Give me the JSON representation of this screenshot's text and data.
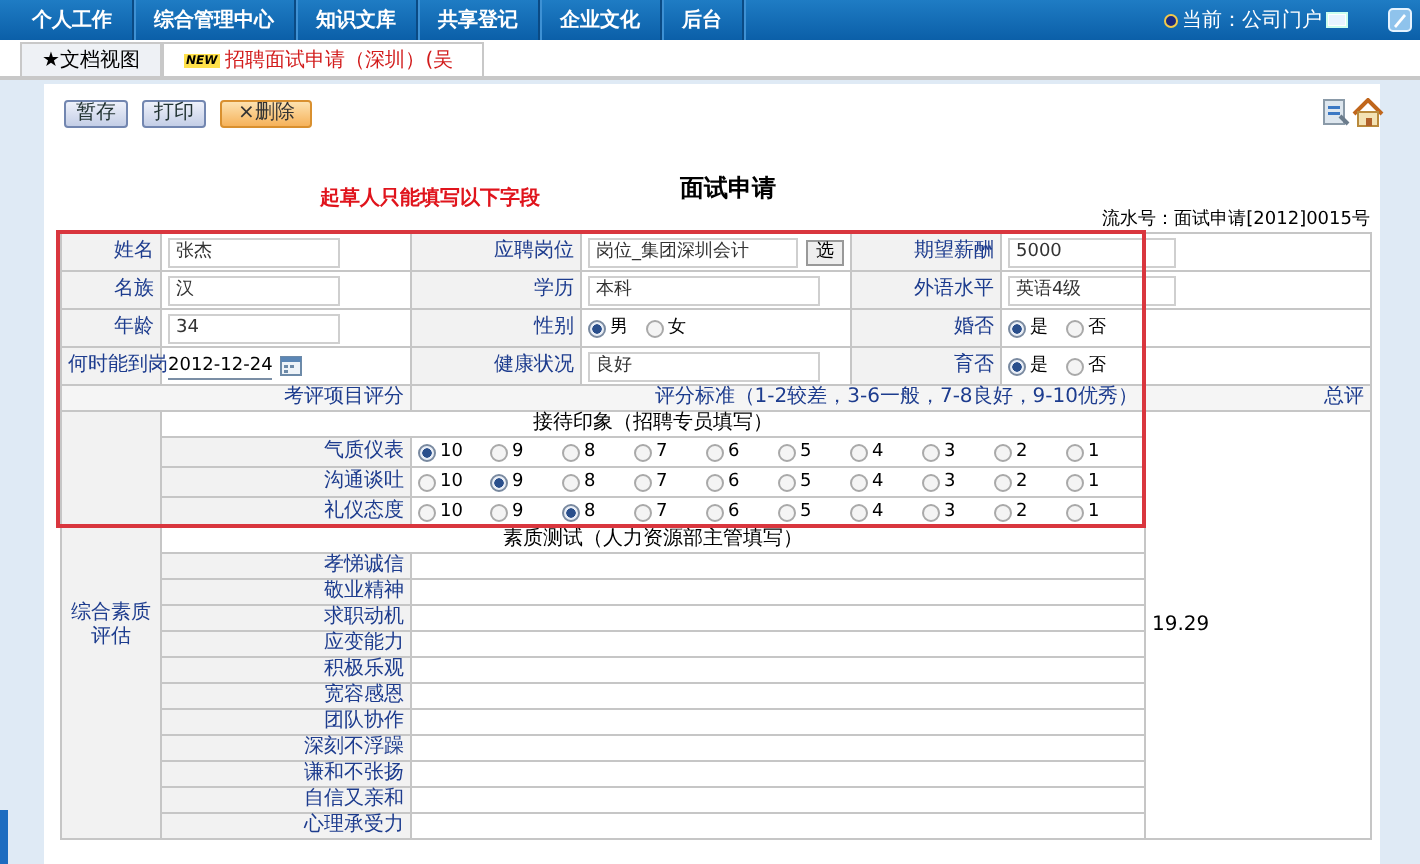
{
  "nav": {
    "items": [
      {
        "label": "个人工作"
      },
      {
        "label": "综合管理中心"
      },
      {
        "label": "知识文库"
      },
      {
        "label": "共享登记"
      },
      {
        "label": "企业文化"
      },
      {
        "label": "后台"
      }
    ],
    "current": "当前：公司门户"
  },
  "tabs": [
    {
      "label": "★文档视图",
      "selected": false
    },
    {
      "label": "招聘面试申请（深圳）(吴",
      "badge": "NEW",
      "selected": true
    }
  ],
  "toolbar": [
    {
      "label": "暂存",
      "kind": "normal"
    },
    {
      "label": "打印",
      "kind": "normal"
    },
    {
      "label": "×删除",
      "kind": "danger"
    }
  ],
  "form": {
    "title": "面试申请",
    "note": "起草人只能填写以下字段",
    "serial": "流水号：面试申请[2012]0015号",
    "rows": [
      [
        {
          "label": "姓名",
          "kind": "text",
          "value": "张杰"
        },
        {
          "label": "应聘岗位",
          "kind": "pick",
          "value": "岗位_集团深圳会计",
          "button": "选"
        },
        {
          "label": "期望薪酬",
          "kind": "text",
          "value": "5000"
        }
      ],
      [
        {
          "label": "名族",
          "kind": "text",
          "value": "汉"
        },
        {
          "label": "学历",
          "kind": "text",
          "value": "本科"
        },
        {
          "label": "外语水平",
          "kind": "text",
          "value": "英语4级"
        }
      ],
      [
        {
          "label": "年龄",
          "kind": "text",
          "value": "34"
        },
        {
          "label": "性别",
          "kind": "radio",
          "options": [
            {
              "label": "男",
              "selected": true
            },
            {
              "label": "女",
              "selected": false
            }
          ]
        },
        {
          "label": "婚否",
          "kind": "radio",
          "options": [
            {
              "label": "是",
              "selected": true
            },
            {
              "label": "否",
              "selected": false
            }
          ]
        }
      ],
      [
        {
          "label": "何时能到岗",
          "kind": "date",
          "value": "2012-12-24"
        },
        {
          "label": "健康状况",
          "kind": "text",
          "value": "良好"
        },
        {
          "label": "育否",
          "kind": "radio",
          "options": [
            {
              "label": "是",
              "selected": true
            },
            {
              "label": "否",
              "selected": false
            }
          ]
        }
      ]
    ]
  },
  "scoring": {
    "heading": "考评项目评分",
    "criteria": "评分标准（1-2较差，3-6一般，7-8良好，9-10优秀）",
    "total_heading": "总评",
    "group": "综合素质评估",
    "total": "19.29",
    "sections": [
      {
        "title": "接待印象（招聘专员填写）",
        "items": [
          {
            "label": "气质仪表",
            "options": [
              {
                "label": "10",
                "selected": true
              },
              {
                "label": "9",
                "selected": false
              },
              {
                "label": "8",
                "selected": false
              },
              {
                "label": "7",
                "selected": false
              },
              {
                "label": "6",
                "selected": false
              },
              {
                "label": "5",
                "selected": false
              },
              {
                "label": "4",
                "selected": false
              },
              {
                "label": "3",
                "selected": false
              },
              {
                "label": "2",
                "selected": false
              },
              {
                "label": "1",
                "selected": false
              }
            ]
          },
          {
            "label": "沟通谈吐",
            "options": [
              {
                "label": "10",
                "selected": false
              },
              {
                "label": "9",
                "selected": true
              },
              {
                "label": "8",
                "selected": false
              },
              {
                "label": "7",
                "selected": false
              },
              {
                "label": "6",
                "selected": false
              },
              {
                "label": "5",
                "selected": false
              },
              {
                "label": "4",
                "selected": false
              },
              {
                "label": "3",
                "selected": false
              },
              {
                "label": "2",
                "selected": false
              },
              {
                "label": "1",
                "selected": false
              }
            ]
          },
          {
            "label": "礼仪态度",
            "options": [
              {
                "label": "10",
                "selected": false
              },
              {
                "label": "9",
                "selected": false
              },
              {
                "label": "8",
                "selected": true
              },
              {
                "label": "7",
                "selected": false
              },
              {
                "label": "6",
                "selected": false
              },
              {
                "label": "5",
                "selected": false
              },
              {
                "label": "4",
                "selected": false
              },
              {
                "label": "3",
                "selected": false
              },
              {
                "label": "2",
                "selected": false
              },
              {
                "label": "1",
                "selected": false
              }
            ]
          }
        ]
      },
      {
        "title": "素质测试（人力资源部主管填写）",
        "items": [
          {
            "label": "孝悌诚信"
          },
          {
            "label": "敬业精神"
          },
          {
            "label": "求职动机"
          },
          {
            "label": "应变能力"
          },
          {
            "label": "积极乐观"
          },
          {
            "label": "宽容感恩"
          },
          {
            "label": "团队协作"
          },
          {
            "label": "深刻不浮躁"
          },
          {
            "label": "谦和不张扬"
          },
          {
            "label": "自信又亲和"
          },
          {
            "label": "心理承受力"
          }
        ]
      }
    ]
  }
}
